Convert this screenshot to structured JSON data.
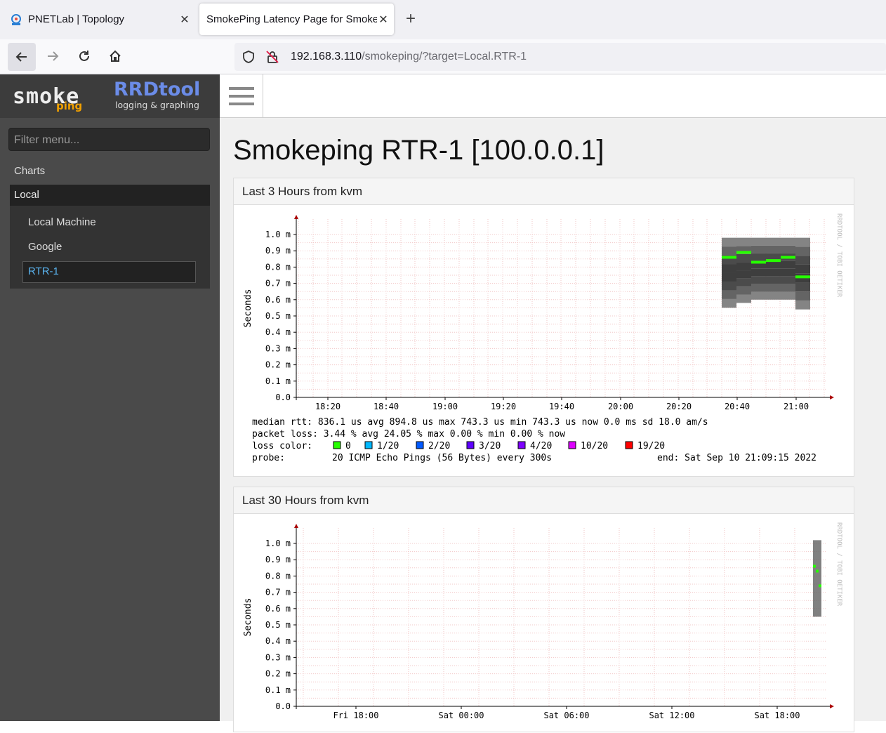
{
  "browser": {
    "tabs": [
      {
        "title": "PNETLab | Topology",
        "active": false
      },
      {
        "title": "SmokePing Latency Page for Smoke",
        "active": true
      }
    ],
    "url_host": "192.168.3.110",
    "url_path": "/smokeping/?target=Local.RTR-1"
  },
  "sidebar": {
    "logo_smoke": "smoke",
    "logo_ping": "ping",
    "logo_rrd": "RRDtool",
    "logo_rrd_sub": "logging & graphing",
    "filter_placeholder": "Filter menu...",
    "charts_label": "Charts",
    "local_label": "Local",
    "items": [
      {
        "label": "Local Machine"
      },
      {
        "label": "Google"
      },
      {
        "label": "RTR-1",
        "selected": true
      }
    ]
  },
  "main": {
    "title": "Smokeping RTR-1 [100.0.0.1]",
    "panels": [
      {
        "heading": "Last 3 Hours from kvm",
        "ylabel": "Seconds",
        "yticks": [
          "1.0 m",
          "0.9 m",
          "0.8 m",
          "0.7 m",
          "0.6 m",
          "0.5 m",
          "0.4 m",
          "0.3 m",
          "0.2 m",
          "0.1 m",
          "0.0"
        ],
        "xticks": [
          "18:20",
          "18:40",
          "19:00",
          "19:20",
          "19:40",
          "20:00",
          "20:20",
          "20:40",
          "21:00"
        ],
        "watermark": "RRDTOOL / TOBI OETIKER",
        "legend": {
          "line1": "median rtt:  836.1 us avg  894.8 us max  743.3 us min  743.3 us now  0.0 ms sd  18.0    am/s",
          "line2": "packet loss: 3.44 % avg  24.05 % max  0.00 % min  0.00 % now",
          "loss_label": "loss color:",
          "loss_items": [
            {
              "label": "0",
              "color": "#26ff00"
            },
            {
              "label": "1/20",
              "color": "#00b8ff"
            },
            {
              "label": "2/20",
              "color": "#0059ff"
            },
            {
              "label": "3/20",
              "color": "#5e00ff"
            },
            {
              "label": "4/20",
              "color": "#7e00ff"
            },
            {
              "label": "10/20",
              "color": "#dd00ff"
            },
            {
              "label": "19/20",
              "color": "#ff0000"
            }
          ],
          "probe_label": "probe:",
          "probe_text": "20 ICMP Echo Pings (56 Bytes) every 300s",
          "end_text": "end: Sat Sep 10 21:09:15 2022"
        }
      },
      {
        "heading": "Last 30 Hours from kvm",
        "ylabel": "Seconds",
        "yticks": [
          "1.0 m",
          "0.9 m",
          "0.8 m",
          "0.7 m",
          "0.6 m",
          "0.5 m",
          "0.4 m",
          "0.3 m",
          "0.2 m",
          "0.1 m",
          "0.0"
        ],
        "xticks": [
          "Fri 18:00",
          "Sat 00:00",
          "Sat 06:00",
          "Sat 12:00",
          "Sat 18:00"
        ],
        "watermark": "RRDTOOL / TOBI OETIKER"
      }
    ]
  },
  "chart_data": [
    {
      "type": "line",
      "title": "Last 3 Hours from kvm",
      "ylabel": "Seconds",
      "x": [
        "20:35",
        "20:40",
        "20:45",
        "20:50",
        "20:55",
        "21:00"
      ],
      "series": [
        {
          "name": "median rtt",
          "values": [
            0.86,
            0.89,
            0.83,
            0.84,
            0.86,
            0.74
          ]
        }
      ],
      "smoke_range": [
        [
          0.55,
          0.98
        ],
        [
          0.58,
          0.98
        ],
        [
          0.6,
          0.98
        ],
        [
          0.6,
          0.98
        ],
        [
          0.6,
          0.98
        ],
        [
          0.54,
          0.98
        ]
      ],
      "ylim": [
        0,
        1.0
      ],
      "grid": true
    },
    {
      "type": "line",
      "title": "Last 30 Hours from kvm",
      "ylabel": "Seconds",
      "x": [
        "Sat 20:40",
        "Sat 20:50",
        "Sat 21:00"
      ],
      "series": [
        {
          "name": "median rtt",
          "values": [
            0.86,
            0.83,
            0.74
          ]
        }
      ],
      "ylim": [
        0,
        1.0
      ],
      "grid": true
    }
  ]
}
